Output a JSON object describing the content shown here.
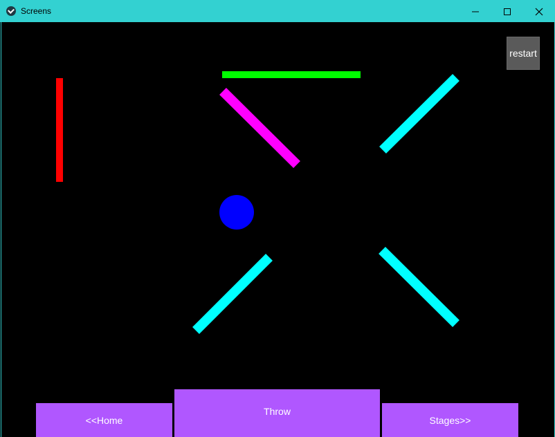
{
  "window": {
    "title": "Screens",
    "app_icon": "kivy-logo-icon",
    "controls": [
      "minimize-icon",
      "maximize-icon",
      "close-icon"
    ]
  },
  "game": {
    "restart_label": "restart",
    "ball": {
      "color": "#0000ff",
      "icon": "ball"
    },
    "bars": [
      {
        "name": "red-bar",
        "color": "#ff0000",
        "orientation": "vertical"
      },
      {
        "name": "green-bar",
        "color": "#00ff00",
        "orientation": "horizontal"
      },
      {
        "name": "magenta-bar",
        "color": "#ff00ff",
        "orientation": "diagonal-down"
      },
      {
        "name": "cyan-bar-top-right",
        "color": "#00ffff",
        "orientation": "diagonal-up"
      },
      {
        "name": "cyan-bar-bottom-left",
        "color": "#00ffff",
        "orientation": "diagonal-up"
      },
      {
        "name": "cyan-bar-bottom-right",
        "color": "#00ffff",
        "orientation": "diagonal-down"
      }
    ]
  },
  "bottom_bar": {
    "home_label": "<<Home",
    "throw_label": "Throw",
    "stages_label": "Stages>>",
    "button_color": "#b057ff"
  }
}
